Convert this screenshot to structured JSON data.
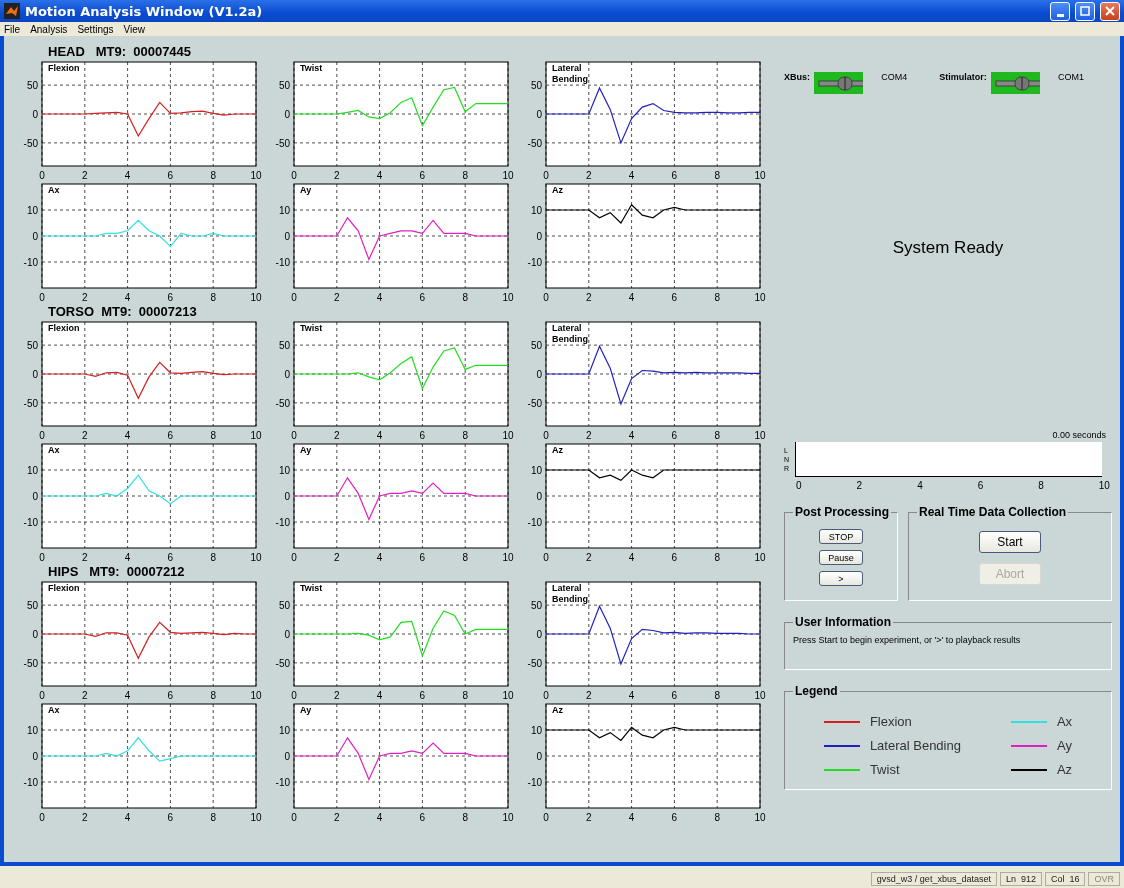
{
  "window": {
    "title": "Motion Analysis Window (V1.2a)"
  },
  "menu": [
    "File",
    "Analysis",
    "Settings",
    "View"
  ],
  "sensors": [
    {
      "header": "HEAD   MT9:  00007445",
      "charts": [
        {
          "chart_data": {
            "type": "line",
            "title": "Flexion",
            "x": [
              0,
              0.5,
              1,
              1.5,
              2,
              2.5,
              3,
              3.5,
              4,
              4.5,
              5,
              5.5,
              6,
              6.5,
              7,
              7.5,
              8,
              8.5,
              9,
              9.5,
              10
            ],
            "series": [
              {
                "color": "#d42020",
                "values": [
                  0,
                  0,
                  0,
                  0,
                  0,
                  1,
                  2,
                  3,
                  0,
                  -38,
                  -8,
                  20,
                  1,
                  2,
                  4,
                  5,
                  1,
                  -2,
                  0,
                  0,
                  0
                ]
              }
            ],
            "xlim": [
              0,
              10
            ],
            "ylim": [
              -90,
              90
            ],
            "xticks": [
              0,
              2,
              4,
              6,
              8,
              10
            ],
            "yticks": [
              -50,
              0,
              50
            ],
            "grid": true
          }
        },
        {
          "chart_data": {
            "type": "line",
            "title": "Twist",
            "x": [
              0,
              0.5,
              1,
              1.5,
              2,
              2.5,
              3,
              3.5,
              4,
              4.5,
              5,
              5.5,
              6,
              6.5,
              7,
              7.5,
              8,
              8.5,
              9,
              9.5,
              10
            ],
            "series": [
              {
                "color": "#22dd22",
                "values": [
                  0,
                  0,
                  0,
                  0,
                  0,
                  3,
                  6,
                  -5,
                  -8,
                  2,
                  20,
                  28,
                  -20,
                  12,
                  42,
                  46,
                  4,
                  18,
                  18,
                  18,
                  18
                ]
              }
            ],
            "xlim": [
              0,
              10
            ],
            "ylim": [
              -90,
              90
            ],
            "xticks": [
              0,
              2,
              4,
              6,
              8,
              10
            ],
            "yticks": [
              -50,
              0,
              50
            ],
            "grid": true
          }
        },
        {
          "chart_data": {
            "type": "line",
            "title": "Lateral Bending",
            "x": [
              0,
              0.5,
              1,
              1.5,
              2,
              2.5,
              3,
              3.5,
              4,
              4.5,
              5,
              5.5,
              6,
              6.5,
              7,
              7.5,
              8,
              8.5,
              9,
              9.5,
              10
            ],
            "series": [
              {
                "color": "#2020c0",
                "values": [
                  0,
                  0,
                  0,
                  0,
                  0,
                  45,
                  8,
                  -50,
                  -8,
                  12,
                  18,
                  6,
                  3,
                  2,
                  2,
                  3,
                  3,
                  2,
                  2,
                  3,
                  3
                ]
              }
            ],
            "xlim": [
              0,
              10
            ],
            "ylim": [
              -90,
              90
            ],
            "xticks": [
              0,
              2,
              4,
              6,
              8,
              10
            ],
            "yticks": [
              -50,
              0,
              50
            ],
            "grid": true
          }
        },
        {
          "chart_data": {
            "type": "line",
            "title": "Ax",
            "x": [
              0,
              0.5,
              1,
              1.5,
              2,
              2.5,
              3,
              3.5,
              4,
              4.5,
              5,
              5.5,
              6,
              6.5,
              7,
              7.5,
              8,
              8.5,
              9,
              9.5,
              10
            ],
            "series": [
              {
                "color": "#30e0e0",
                "values": [
                  0,
                  0,
                  0,
                  0,
                  0,
                  0,
                  1,
                  1,
                  2,
                  6,
                  2,
                  0,
                  -4,
                  1,
                  0,
                  0,
                  1,
                  0,
                  0,
                  0,
                  0
                ]
              }
            ],
            "xlim": [
              0,
              10
            ],
            "ylim": [
              -20,
              20
            ],
            "xticks": [
              0,
              2,
              4,
              6,
              8,
              10
            ],
            "yticks": [
              -10,
              0,
              10
            ],
            "grid": true
          }
        },
        {
          "chart_data": {
            "type": "line",
            "title": "Ay",
            "x": [
              0,
              0.5,
              1,
              1.5,
              2,
              2.5,
              3,
              3.5,
              4,
              4.5,
              5,
              5.5,
              6,
              6.5,
              7,
              7.5,
              8,
              8.5,
              9,
              9.5,
              10
            ],
            "series": [
              {
                "color": "#e020c0",
                "values": [
                  0,
                  0,
                  0,
                  0,
                  0,
                  7,
                  2,
                  -9,
                  0,
                  1,
                  2,
                  2,
                  1,
                  6,
                  1,
                  1,
                  1,
                  0,
                  0,
                  0,
                  0
                ]
              }
            ],
            "xlim": [
              0,
              10
            ],
            "ylim": [
              -20,
              20
            ],
            "xticks": [
              0,
              2,
              4,
              6,
              8,
              10
            ],
            "yticks": [
              -10,
              0,
              10
            ],
            "grid": true
          }
        },
        {
          "chart_data": {
            "type": "line",
            "title": "Az",
            "x": [
              0,
              0.5,
              1,
              1.5,
              2,
              2.5,
              3,
              3.5,
              4,
              4.5,
              5,
              5.5,
              6,
              6.5,
              7,
              7.5,
              8,
              8.5,
              9,
              9.5,
              10
            ],
            "series": [
              {
                "color": "#000000",
                "values": [
                  10,
                  10,
                  10,
                  10,
                  10,
                  7,
                  9,
                  5,
                  12,
                  8,
                  7,
                  10,
                  11,
                  10,
                  10,
                  10,
                  10,
                  10,
                  10,
                  10,
                  10
                ]
              }
            ],
            "xlim": [
              0,
              10
            ],
            "ylim": [
              -20,
              20
            ],
            "xticks": [
              0,
              2,
              4,
              6,
              8,
              10
            ],
            "yticks": [
              -10,
              0,
              10
            ],
            "grid": true
          }
        }
      ]
    },
    {
      "header": "TORSO  MT9:  00007213",
      "charts": [
        {
          "chart_data": {
            "type": "line",
            "title": "Flexion",
            "x": [
              0,
              0.5,
              1,
              1.5,
              2,
              2.5,
              3,
              3.5,
              4,
              4.5,
              5,
              5.5,
              6,
              6.5,
              7,
              7.5,
              8,
              8.5,
              9,
              9.5,
              10
            ],
            "series": [
              {
                "color": "#d42020",
                "values": [
                  0,
                  0,
                  0,
                  0,
                  0,
                  -4,
                  2,
                  3,
                  -2,
                  -42,
                  -5,
                  20,
                  2,
                  1,
                  3,
                  4,
                  1,
                  -1,
                  0,
                  0,
                  0
                ]
              }
            ],
            "xlim": [
              0,
              10
            ],
            "ylim": [
              -90,
              90
            ],
            "xticks": [
              0,
              2,
              4,
              6,
              8,
              10
            ],
            "yticks": [
              -50,
              0,
              50
            ],
            "grid": true
          }
        },
        {
          "chart_data": {
            "type": "line",
            "title": "Twist",
            "x": [
              0,
              0.5,
              1,
              1.5,
              2,
              2.5,
              3,
              3.5,
              4,
              4.5,
              5,
              5.5,
              6,
              6.5,
              7,
              7.5,
              8,
              8.5,
              9,
              9.5,
              10
            ],
            "series": [
              {
                "color": "#22dd22",
                "values": [
                  0,
                  0,
                  0,
                  0,
                  0,
                  0,
                  2,
                  -5,
                  -10,
                  2,
                  18,
                  30,
                  -25,
                  12,
                  40,
                  45,
                  8,
                  15,
                  15,
                  15,
                  15
                ]
              }
            ],
            "xlim": [
              0,
              10
            ],
            "ylim": [
              -90,
              90
            ],
            "xticks": [
              0,
              2,
              4,
              6,
              8,
              10
            ],
            "yticks": [
              -50,
              0,
              50
            ],
            "grid": true
          }
        },
        {
          "chart_data": {
            "type": "line",
            "title": "Lateral Bending",
            "x": [
              0,
              0.5,
              1,
              1.5,
              2,
              2.5,
              3,
              3.5,
              4,
              4.5,
              5,
              5.5,
              6,
              6.5,
              7,
              7.5,
              8,
              8.5,
              9,
              9.5,
              10
            ],
            "series": [
              {
                "color": "#2020c0",
                "values": [
                  0,
                  0,
                  0,
                  0,
                  0,
                  48,
                  10,
                  -52,
                  -8,
                  6,
                  5,
                  2,
                  3,
                  2,
                  3,
                  2,
                  2,
                  2,
                  2,
                  1,
                  1
                ]
              }
            ],
            "xlim": [
              0,
              10
            ],
            "ylim": [
              -90,
              90
            ],
            "xticks": [
              0,
              2,
              4,
              6,
              8,
              10
            ],
            "yticks": [
              -50,
              0,
              50
            ],
            "grid": true
          }
        },
        {
          "chart_data": {
            "type": "line",
            "title": "Ax",
            "x": [
              0,
              0.5,
              1,
              1.5,
              2,
              2.5,
              3,
              3.5,
              4,
              4.5,
              5,
              5.5,
              6,
              6.5,
              7,
              7.5,
              8,
              8.5,
              9,
              9.5,
              10
            ],
            "series": [
              {
                "color": "#30e0e0",
                "values": [
                  0,
                  0,
                  0,
                  0,
                  0,
                  0,
                  1,
                  0,
                  3,
                  8,
                  2,
                  0,
                  -3,
                  0,
                  0,
                  0,
                  0,
                  0,
                  0,
                  0,
                  0
                ]
              }
            ],
            "xlim": [
              0,
              10
            ],
            "ylim": [
              -20,
              20
            ],
            "xticks": [
              0,
              2,
              4,
              6,
              8,
              10
            ],
            "yticks": [
              -10,
              0,
              10
            ],
            "grid": true
          }
        },
        {
          "chart_data": {
            "type": "line",
            "title": "Ay",
            "x": [
              0,
              0.5,
              1,
              1.5,
              2,
              2.5,
              3,
              3.5,
              4,
              4.5,
              5,
              5.5,
              6,
              6.5,
              7,
              7.5,
              8,
              8.5,
              9,
              9.5,
              10
            ],
            "series": [
              {
                "color": "#e020c0",
                "values": [
                  0,
                  0,
                  0,
                  0,
                  0,
                  7,
                  1,
                  -9,
                  0,
                  1,
                  1,
                  2,
                  1,
                  5,
                  1,
                  1,
                  1,
                  0,
                  0,
                  0,
                  0
                ]
              }
            ],
            "xlim": [
              0,
              10
            ],
            "ylim": [
              -20,
              20
            ],
            "xticks": [
              0,
              2,
              4,
              6,
              8,
              10
            ],
            "yticks": [
              -10,
              0,
              10
            ],
            "grid": true
          }
        },
        {
          "chart_data": {
            "type": "line",
            "title": "Az",
            "x": [
              0,
              0.5,
              1,
              1.5,
              2,
              2.5,
              3,
              3.5,
              4,
              4.5,
              5,
              5.5,
              6,
              6.5,
              7,
              7.5,
              8,
              8.5,
              9,
              9.5,
              10
            ],
            "series": [
              {
                "color": "#000000",
                "values": [
                  10,
                  10,
                  10,
                  10,
                  10,
                  7,
                  8,
                  6,
                  10,
                  8,
                  7,
                  10,
                  10,
                  10,
                  10,
                  10,
                  10,
                  10,
                  10,
                  10,
                  10
                ]
              }
            ],
            "xlim": [
              0,
              10
            ],
            "ylim": [
              -20,
              20
            ],
            "xticks": [
              0,
              2,
              4,
              6,
              8,
              10
            ],
            "yticks": [
              -10,
              0,
              10
            ],
            "grid": true
          }
        }
      ]
    },
    {
      "header": "HIPS   MT9:  00007212",
      "charts": [
        {
          "chart_data": {
            "type": "line",
            "title": "Flexion",
            "x": [
              0,
              0.5,
              1,
              1.5,
              2,
              2.5,
              3,
              3.5,
              4,
              4.5,
              5,
              5.5,
              6,
              6.5,
              7,
              7.5,
              8,
              8.5,
              9,
              9.5,
              10
            ],
            "series": [
              {
                "color": "#d42020",
                "values": [
                  0,
                  0,
                  0,
                  0,
                  0,
                  -4,
                  2,
                  2,
                  -2,
                  -42,
                  -5,
                  20,
                  3,
                  1,
                  2,
                  3,
                  1,
                  -1,
                  1,
                  0,
                  0
                ]
              }
            ],
            "xlim": [
              0,
              10
            ],
            "ylim": [
              -90,
              90
            ],
            "xticks": [
              0,
              2,
              4,
              6,
              8,
              10
            ],
            "yticks": [
              -50,
              0,
              50
            ],
            "grid": true
          }
        },
        {
          "chart_data": {
            "type": "line",
            "title": "Twist",
            "x": [
              0,
              0.5,
              1,
              1.5,
              2,
              2.5,
              3,
              3.5,
              4,
              4.5,
              5,
              5.5,
              6,
              6.5,
              7,
              7.5,
              8,
              8.5,
              9,
              9.5,
              10
            ],
            "series": [
              {
                "color": "#22dd22",
                "values": [
                  0,
                  0,
                  0,
                  0,
                  0,
                  0,
                  1,
                  -2,
                  -10,
                  -5,
                  20,
                  22,
                  -38,
                  10,
                  40,
                  32,
                  0,
                  8,
                  8,
                  8,
                  8
                ]
              }
            ],
            "xlim": [
              0,
              10
            ],
            "ylim": [
              -90,
              90
            ],
            "xticks": [
              0,
              2,
              4,
              6,
              8,
              10
            ],
            "yticks": [
              -50,
              0,
              50
            ],
            "grid": true
          }
        },
        {
          "chart_data": {
            "type": "line",
            "title": "Lateral Bending",
            "x": [
              0,
              0.5,
              1,
              1.5,
              2,
              2.5,
              3,
              3.5,
              4,
              4.5,
              5,
              5.5,
              6,
              6.5,
              7,
              7.5,
              8,
              8.5,
              9,
              9.5,
              10
            ],
            "series": [
              {
                "color": "#2020c0",
                "values": [
                  0,
                  0,
                  0,
                  0,
                  0,
                  48,
                  10,
                  -52,
                  -8,
                  8,
                  6,
                  2,
                  3,
                  1,
                  2,
                  2,
                  1,
                  1,
                  1,
                  0,
                  0
                ]
              }
            ],
            "xlim": [
              0,
              10
            ],
            "ylim": [
              -90,
              90
            ],
            "xticks": [
              0,
              2,
              4,
              6,
              8,
              10
            ],
            "yticks": [
              -50,
              0,
              50
            ],
            "grid": true
          }
        },
        {
          "chart_data": {
            "type": "line",
            "title": "Ax",
            "x": [
              0,
              0.5,
              1,
              1.5,
              2,
              2.5,
              3,
              3.5,
              4,
              4.5,
              5,
              5.5,
              6,
              6.5,
              7,
              7.5,
              8,
              8.5,
              9,
              9.5,
              10
            ],
            "series": [
              {
                "color": "#30e0e0",
                "values": [
                  0,
                  0,
                  0,
                  0,
                  0,
                  0,
                  1,
                  0,
                  2,
                  7,
                  2,
                  -2,
                  -1,
                  0,
                  0,
                  0,
                  0,
                  0,
                  0,
                  0,
                  0
                ]
              }
            ],
            "xlim": [
              0,
              10
            ],
            "ylim": [
              -20,
              20
            ],
            "xticks": [
              0,
              2,
              4,
              6,
              8,
              10
            ],
            "yticks": [
              -10,
              0,
              10
            ],
            "grid": true
          }
        },
        {
          "chart_data": {
            "type": "line",
            "title": "Ay",
            "x": [
              0,
              0.5,
              1,
              1.5,
              2,
              2.5,
              3,
              3.5,
              4,
              4.5,
              5,
              5.5,
              6,
              6.5,
              7,
              7.5,
              8,
              8.5,
              9,
              9.5,
              10
            ],
            "series": [
              {
                "color": "#e020c0",
                "values": [
                  0,
                  0,
                  0,
                  0,
                  0,
                  7,
                  1,
                  -9,
                  0,
                  1,
                  1,
                  2,
                  1,
                  5,
                  1,
                  1,
                  1,
                  0,
                  0,
                  0,
                  0
                ]
              }
            ],
            "xlim": [
              0,
              10
            ],
            "ylim": [
              -20,
              20
            ],
            "xticks": [
              0,
              2,
              4,
              6,
              8,
              10
            ],
            "yticks": [
              -10,
              0,
              10
            ],
            "grid": true
          }
        },
        {
          "chart_data": {
            "type": "line",
            "title": "Az",
            "x": [
              0,
              0.5,
              1,
              1.5,
              2,
              2.5,
              3,
              3.5,
              4,
              4.5,
              5,
              5.5,
              6,
              6.5,
              7,
              7.5,
              8,
              8.5,
              9,
              9.5,
              10
            ],
            "series": [
              {
                "color": "#000000",
                "values": [
                  10,
                  10,
                  10,
                  10,
                  10,
                  7,
                  9,
                  6,
                  11,
                  8,
                  7,
                  10,
                  11,
                  10,
                  10,
                  10,
                  10,
                  10,
                  10,
                  10,
                  10
                ]
              }
            ],
            "xlim": [
              0,
              10
            ],
            "ylim": [
              -20,
              20
            ],
            "xticks": [
              0,
              2,
              4,
              6,
              8,
              10
            ],
            "yticks": [
              -10,
              0,
              10
            ],
            "grid": true
          }
        }
      ]
    }
  ],
  "connections": [
    {
      "label": "XBus:",
      "port": "COM4",
      "on": true
    },
    {
      "label": "Stimulator:",
      "port": "COM1",
      "on": true
    }
  ],
  "status": "System Ready",
  "timeline": {
    "readout": "0.00 seconds",
    "rows": [
      "L",
      "N",
      "R"
    ],
    "ticks": [
      "0",
      "2",
      "4",
      "6",
      "8",
      "10"
    ]
  },
  "post_processing": {
    "title": "Post Processing",
    "buttons": [
      {
        "label": "STOP",
        "disabled": false
      },
      {
        "label": "Pause",
        "disabled": false
      },
      {
        "label": ">",
        "disabled": false
      }
    ]
  },
  "real_time": {
    "title": "Real Time Data Collection",
    "buttons": [
      {
        "label": "Start",
        "disabled": false
      },
      {
        "label": "Abort",
        "disabled": true
      }
    ]
  },
  "user_information": {
    "title": "User Information",
    "message": "Press Start to begin experiment, or '>' to playback results"
  },
  "legend": {
    "title": "Legend",
    "items": [
      {
        "label": "Flexion",
        "color": "#d42020"
      },
      {
        "label": "Ax",
        "color": "#30e0e0"
      },
      {
        "label": "Lateral Bending",
        "color": "#2020c0"
      },
      {
        "label": "Ay",
        "color": "#e020c0"
      },
      {
        "label": "Twist",
        "color": "#22dd22"
      },
      {
        "label": "Az",
        "color": "#000000"
      }
    ]
  },
  "status_bar": [
    {
      "text": "gvsd_w3 / get_xbus_dataset",
      "disabled": false
    },
    {
      "text": "Ln  912",
      "disabled": false
    },
    {
      "text": "Col  16",
      "disabled": false
    },
    {
      "text": "OVR",
      "disabled": true
    }
  ]
}
